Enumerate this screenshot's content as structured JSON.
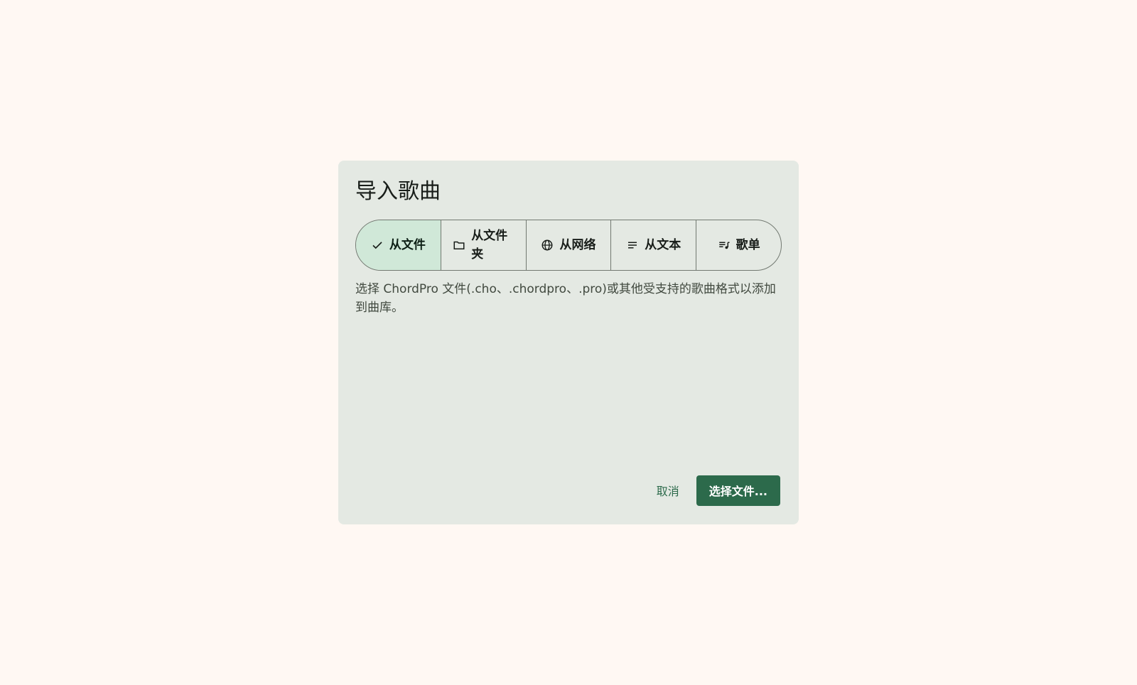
{
  "dialog": {
    "title": "导入歌曲",
    "description": "选择 ChordPro 文件(.cho、.chordpro、.pro)或其他受支持的歌曲格式以添加到曲库。",
    "segments": [
      {
        "label": "从文件",
        "icon": "check-icon",
        "selected": true
      },
      {
        "label": "从文件夹",
        "icon": "folder-icon",
        "selected": false
      },
      {
        "label": "从网络",
        "icon": "globe-icon",
        "selected": false
      },
      {
        "label": "从文本",
        "icon": "notes-icon",
        "selected": false
      },
      {
        "label": "歌单",
        "icon": "playlist-icon",
        "selected": false
      }
    ],
    "cancel_label": "取消",
    "confirm_label": "选择文件..."
  },
  "colors": {
    "background": "#fff8f3",
    "dialog": "#e4e9e3",
    "selected_segment": "#d0e8d8",
    "primary": "#2c6a4b"
  }
}
